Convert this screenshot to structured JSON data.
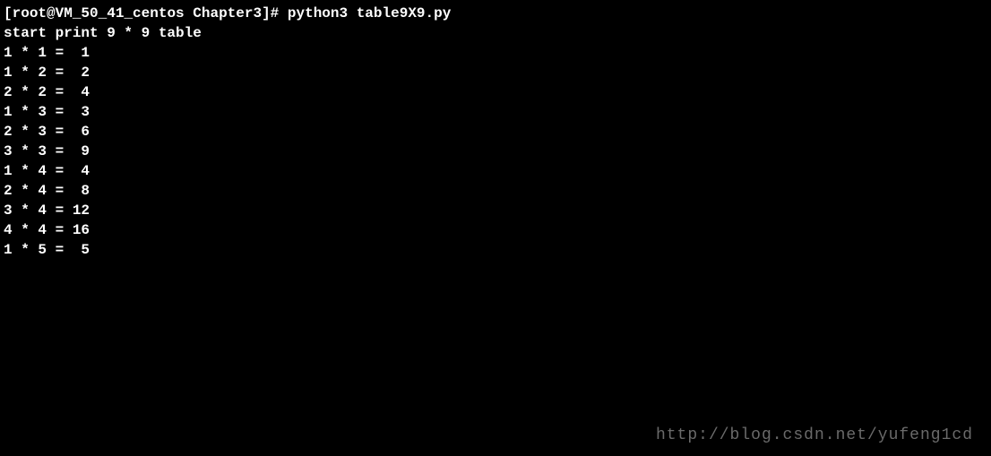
{
  "prompt": {
    "user": "root",
    "host": "VM_50_41_centos",
    "dir": "Chapter3",
    "command": "python3 table9X9.py"
  },
  "header_line": "start print 9 * 9 table",
  "output_lines": [
    "1 * 1 =  1",
    "",
    "",
    "1 * 2 =  2",
    "2 * 2 =  4",
    "",
    "",
    "1 * 3 =  3",
    "2 * 3 =  6",
    "3 * 3 =  9",
    "",
    "",
    "1 * 4 =  4",
    "2 * 4 =  8",
    "3 * 4 = 12",
    "4 * 4 = 16",
    "",
    "",
    "1 * 5 =  5"
  ],
  "watermark": "http://blog.csdn.net/yufeng1cd"
}
